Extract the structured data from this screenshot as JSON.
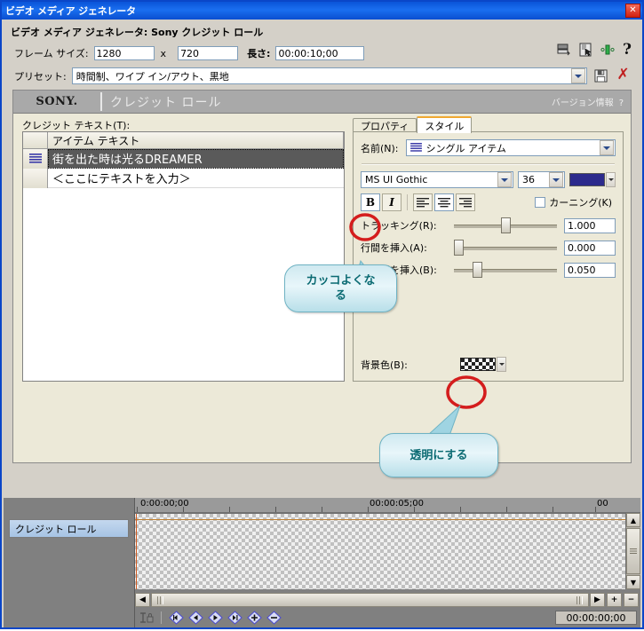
{
  "window": {
    "title": "ビデオ メディア ジェネレータ",
    "close_label": "✕"
  },
  "header": {
    "subtitle": "ビデオ メディア ジェネレータ: Sony クレジット ロール",
    "frame_size_label": "フレーム サイズ:",
    "frame_width": "1280",
    "frame_sep": "x",
    "frame_height": "720",
    "length_label": "長さ:",
    "length_value": "00:00:10;00",
    "icons": {
      "split_preview": "split-preview-icon",
      "select_tool": "select-tool-icon",
      "keyframe": "keyframe-icon",
      "help": "?"
    }
  },
  "preset": {
    "label": "プリセット:",
    "value": "時間制、ワイプ イン/アウト、黒地",
    "save_icon": "save-icon",
    "delete_icon": "✗"
  },
  "plugin": {
    "brand": "SONY.",
    "name": "クレジット ロール",
    "version_label": "バージョン情報",
    "version_help": "?"
  },
  "credits": {
    "label": "クレジット テキスト(T):",
    "columns": [
      "",
      "アイテム テキスト"
    ],
    "rows": [
      {
        "icon": "single-item-icon",
        "text": "街を出た時は光るDREAMER",
        "selected": true
      },
      {
        "icon": "",
        "text": "＜ここにテキストを入力＞",
        "selected": false
      }
    ]
  },
  "tabs": [
    {
      "label": "プロパティ",
      "active": false
    },
    {
      "label": "スタイル",
      "active": true
    }
  ],
  "style": {
    "name_label": "名前(N):",
    "name_value": "シングル アイテム",
    "font_name": "MS UI Gothic",
    "font_size": "36",
    "text_color": "#2c2a8c",
    "bold_label": "B",
    "italic_label": "I",
    "align": {
      "left": "align-left",
      "center": "align-center",
      "right": "align-right",
      "selected": "center"
    },
    "kerning_label": "カーニング(K)",
    "kerning_checked": false,
    "sliders": [
      {
        "label": "トラッキング(R):",
        "value": "1.000",
        "pos_pct": 50
      },
      {
        "label": "行間を挿入(A):",
        "value": "0.000",
        "pos_pct": 0
      },
      {
        "label": "文字間を挿入(B):",
        "value": "0.050",
        "pos_pct": 20
      }
    ],
    "bg_label": "背景色(B):",
    "bg_value": "transparent-checker"
  },
  "annotations": [
    {
      "text": "カッコよくな\nる",
      "target": "bold-button"
    },
    {
      "text": "透明にする",
      "target": "background-color-swatch"
    }
  ],
  "timeline": {
    "track_name": "クレジット ロール",
    "ruler_labels": [
      "0:00:00;00",
      "00:00:05;00",
      "00"
    ],
    "timecode": "00:00:00;00",
    "lock_icon": "lock-icon",
    "keyframe_buttons": [
      "first-keyframe-icon",
      "prev-keyframe-icon",
      "next-keyframe-icon",
      "last-keyframe-icon",
      "add-keyframe-icon",
      "remove-keyframe-icon"
    ],
    "hscroll": {
      "left": "◀",
      "right": "▶",
      "zoom_in": "+",
      "zoom_out": "−"
    },
    "vscroll": {
      "up": "▲",
      "down": "▼"
    }
  }
}
